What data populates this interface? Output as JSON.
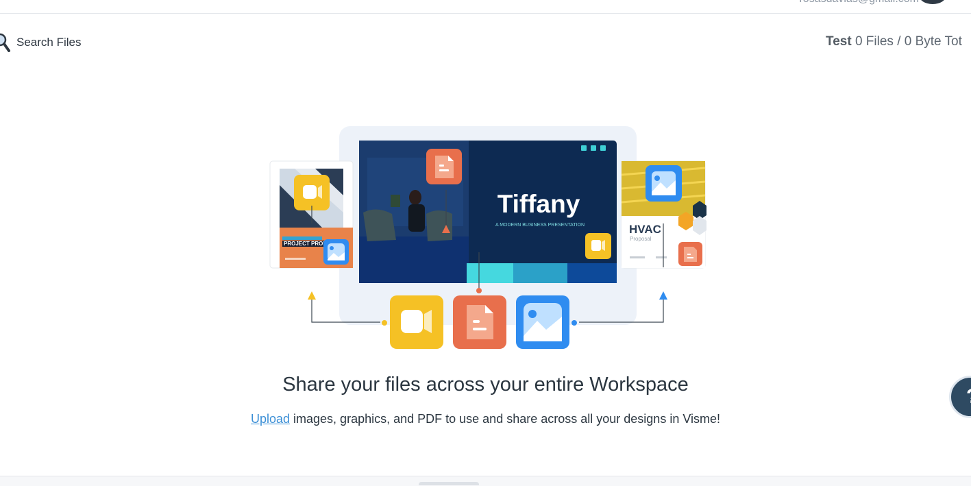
{
  "header": {
    "user_email": "rosasdavias@gmail.com"
  },
  "search": {
    "label": "Search Files",
    "icon": "search-icon"
  },
  "storage": {
    "workspace": "Test",
    "summary": "0 Files / 0 Byte Tot"
  },
  "illustration": {
    "presentation_title": "Tiffany",
    "presentation_subtitle": "A MODERN BUSINESS PRESENTATION",
    "left_card_text": "PROJECT PROPOSAL",
    "right_card_title": "HVAC",
    "right_card_subtitle": "Proposal"
  },
  "empty_state": {
    "headline": "Share your files across your entire Workspace",
    "upload_link": "Upload",
    "description": " images, graphics, and PDF to use and share across all your designs in Visme!"
  },
  "help": {
    "label": "?"
  },
  "colors": {
    "accent_link": "#3b8fd6",
    "video_yellow": "#f5c125",
    "doc_orange": "#e86f4c",
    "image_blue": "#2f8cf0",
    "navy": "#0d2a52"
  }
}
